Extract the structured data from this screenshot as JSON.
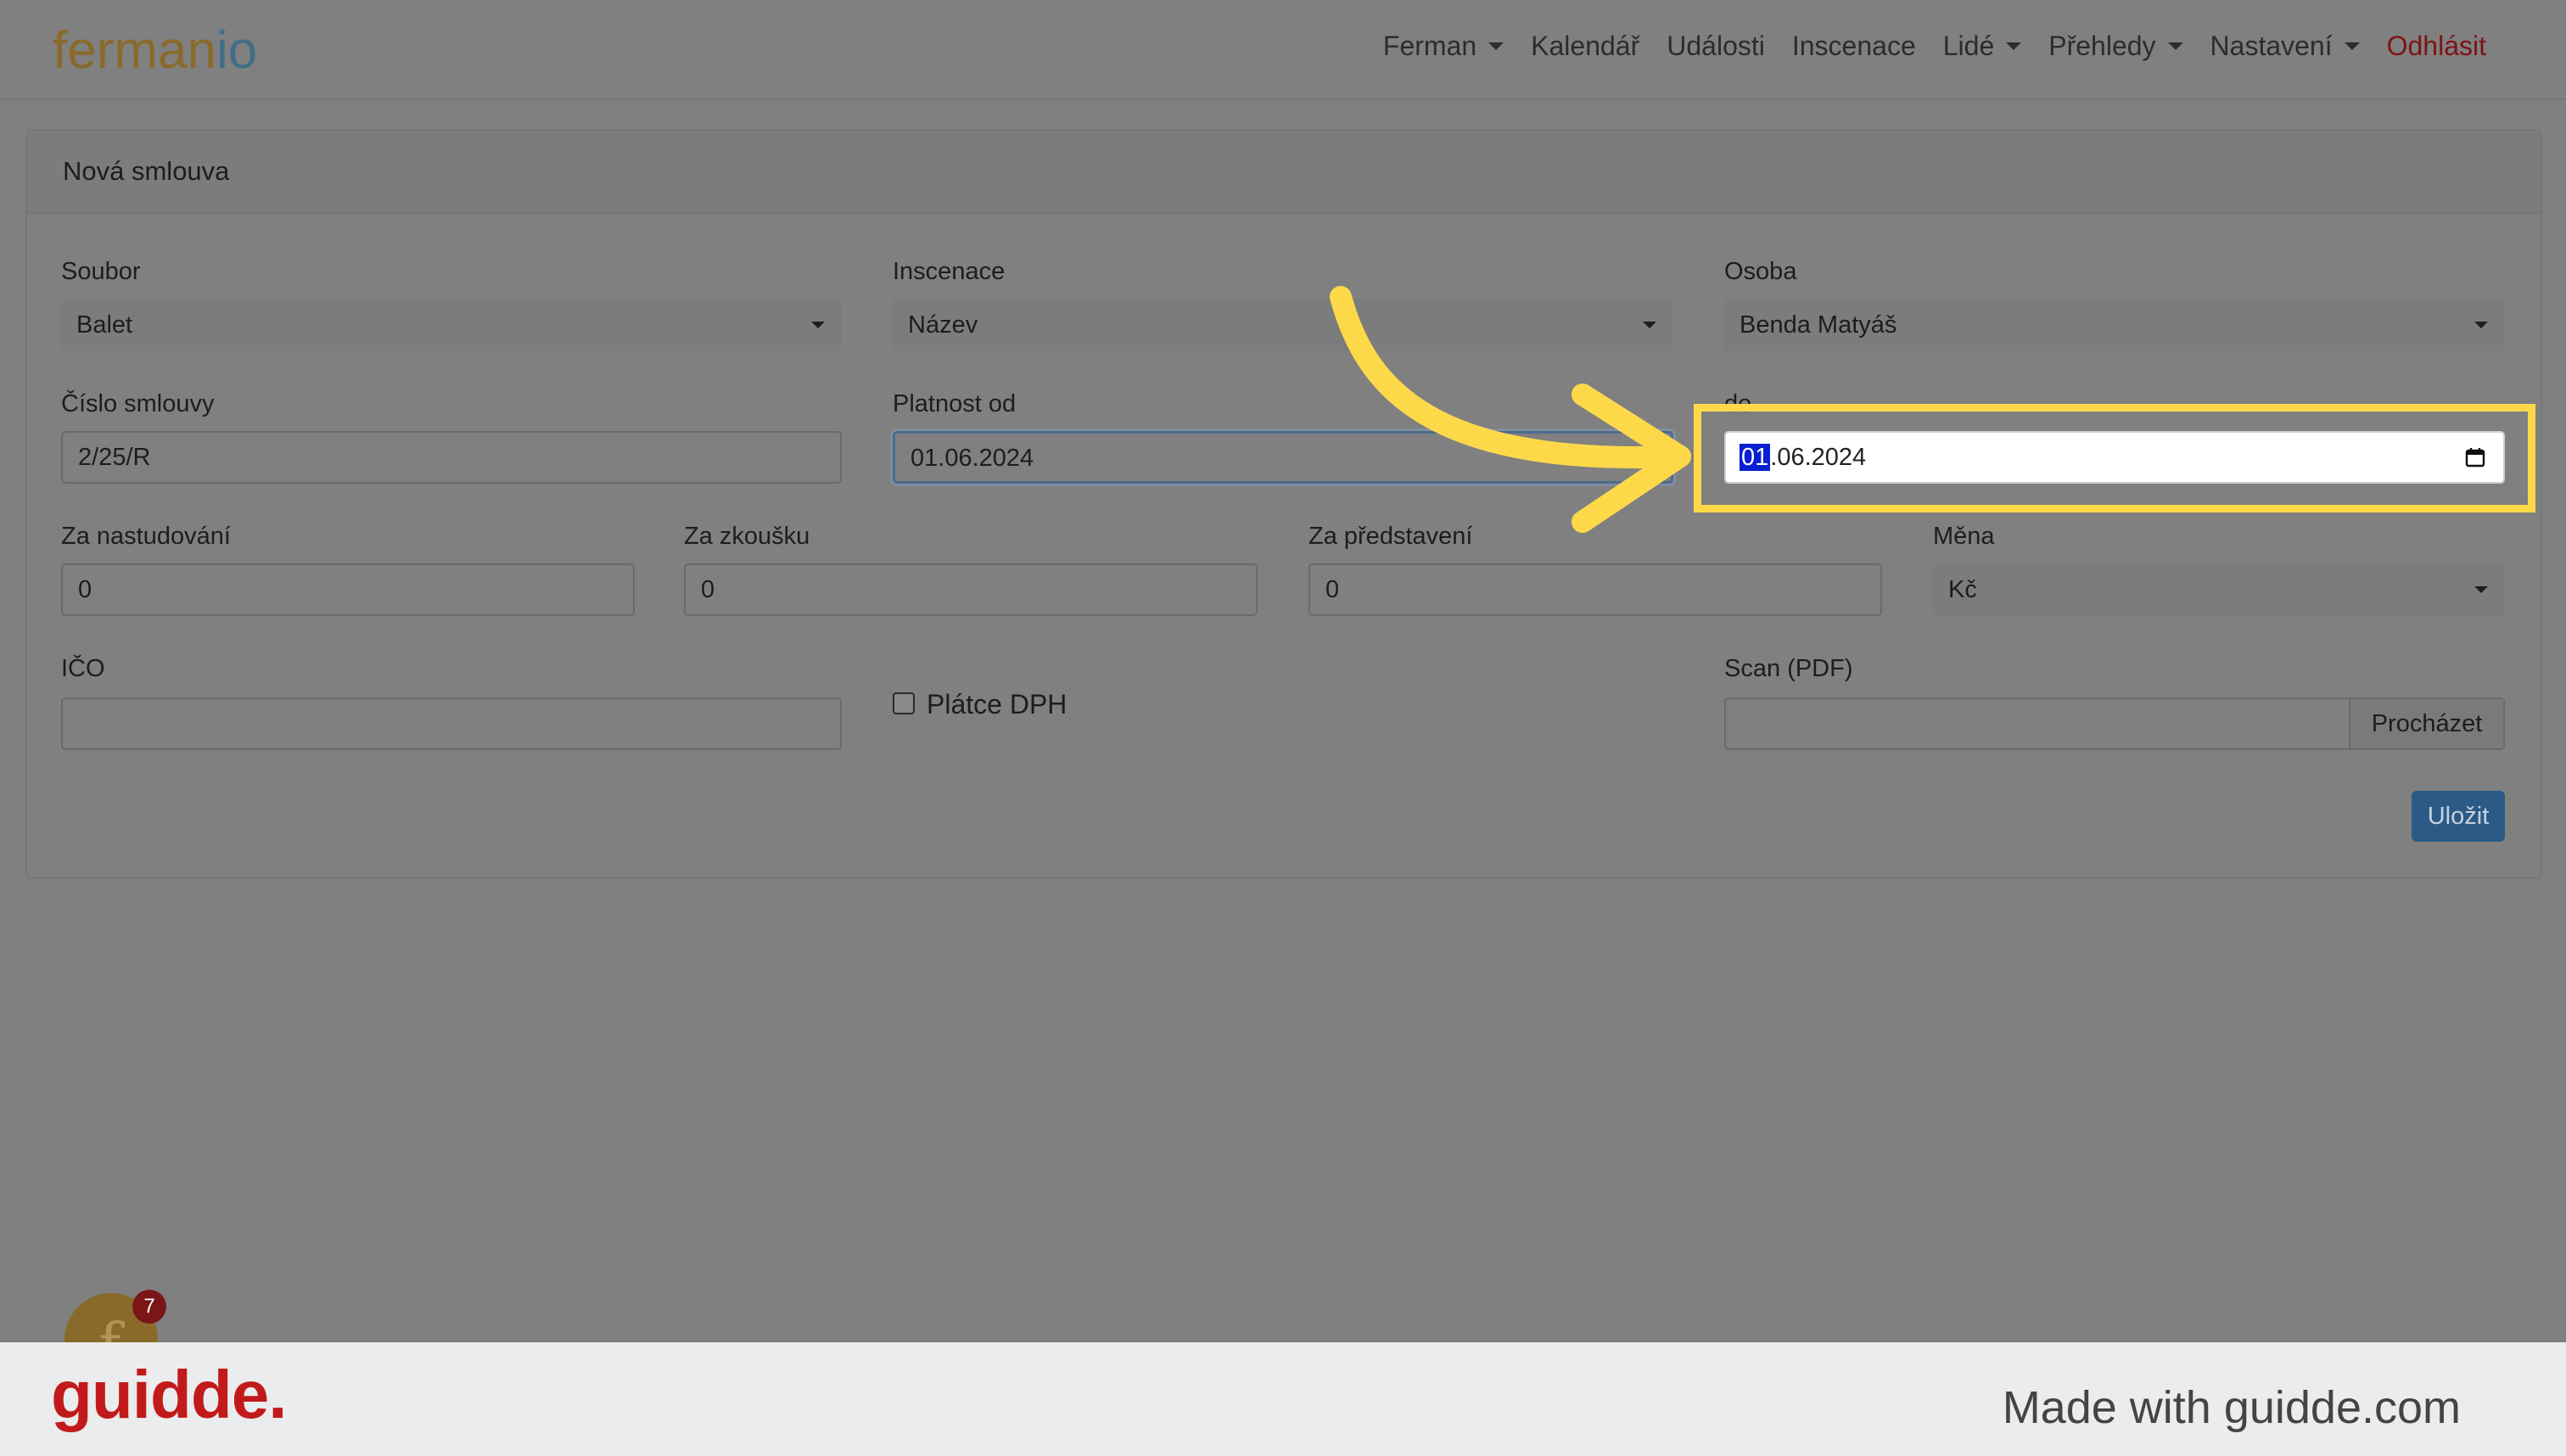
{
  "brand": {
    "part1": "ferman",
    "part2": "io"
  },
  "nav": {
    "items": [
      {
        "label": "Ferman",
        "dropdown": true
      },
      {
        "label": "Kalendář",
        "dropdown": false
      },
      {
        "label": "Události",
        "dropdown": false
      },
      {
        "label": "Inscenace",
        "dropdown": false
      },
      {
        "label": "Lidé",
        "dropdown": true
      },
      {
        "label": "Přehledy",
        "dropdown": true
      },
      {
        "label": "Nastavení",
        "dropdown": true
      }
    ],
    "logout": "Odhlásit"
  },
  "card": {
    "title": "Nová smlouva"
  },
  "form": {
    "soubor": {
      "label": "Soubor",
      "value": "Balet"
    },
    "inscenace": {
      "label": "Inscenace",
      "value": "Název"
    },
    "osoba": {
      "label": "Osoba",
      "value": "Benda Matyáš"
    },
    "cislo": {
      "label": "Číslo smlouvy",
      "value": "2/25/R"
    },
    "platnost_od": {
      "label": "Platnost od",
      "value": "01.06.2024"
    },
    "do": {
      "label": "do",
      "value_selected": "01",
      "value_rest": ".06.2024"
    },
    "za_nastudovani": {
      "label": "Za nastudování",
      "value": "0"
    },
    "za_zkousku": {
      "label": "Za zkoušku",
      "value": "0"
    },
    "za_predstaveni": {
      "label": "Za představení",
      "value": "0"
    },
    "mena": {
      "label": "Měna",
      "value": "Kč"
    },
    "ico": {
      "label": "IČO",
      "value": ""
    },
    "platce_dph": {
      "label": "Plátce DPH",
      "checked": false
    },
    "scan": {
      "label": "Scan (PDF)",
      "browse": "Procházet"
    },
    "save": "Uložit"
  },
  "chat": {
    "letter": "f",
    "badge": "7"
  },
  "footer": {
    "logo": "guidde.",
    "made_with": "Made with guidde.com"
  },
  "colors": {
    "highlight": "#fdd94a",
    "logout": "#7c1414",
    "footer_logo": "#c21a1a"
  }
}
